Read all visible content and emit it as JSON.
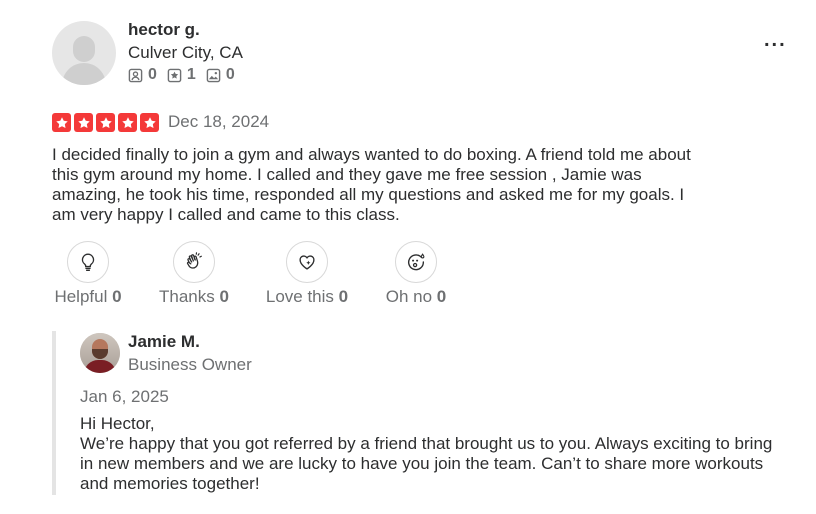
{
  "reviewer": {
    "name": "hector g.",
    "location": "Culver City, CA",
    "stats": [
      {
        "icon": "friends-icon",
        "count": "0"
      },
      {
        "icon": "reviews-icon",
        "count": "1"
      },
      {
        "icon": "photos-icon",
        "count": "0"
      }
    ]
  },
  "review": {
    "rating": 5,
    "date": "Dec 18, 2024",
    "text": "I decided finally to join a gym and always wanted to do boxing. A friend told me about this gym around my home. I called and they gave me free session , Jamie was amazing, he took his time, responded all my questions and asked me for my goals. I am very happy I called and came to this class.",
    "star_color": "#f43939"
  },
  "reactions": [
    {
      "label": "Helpful",
      "count": "0",
      "icon": "lightbulb-icon"
    },
    {
      "label": "Thanks",
      "count": "0",
      "icon": "clapping-hands-icon"
    },
    {
      "label": "Love this",
      "count": "0",
      "icon": "heart-sparkle-icon"
    },
    {
      "label": "Oh no",
      "count": "0",
      "icon": "surprised-face-icon"
    }
  ],
  "reply": {
    "name": "Jamie M.",
    "role": "Business Owner",
    "date": "Jan 6, 2025",
    "greeting": "Hi Hector,",
    "text": "We’re happy that you got referred by a friend that brought us to you. Always exciting to bring in new members and we are lucky to have you join the team. Can’t to share more workouts and memories together!"
  },
  "menu": {
    "label": "..."
  }
}
